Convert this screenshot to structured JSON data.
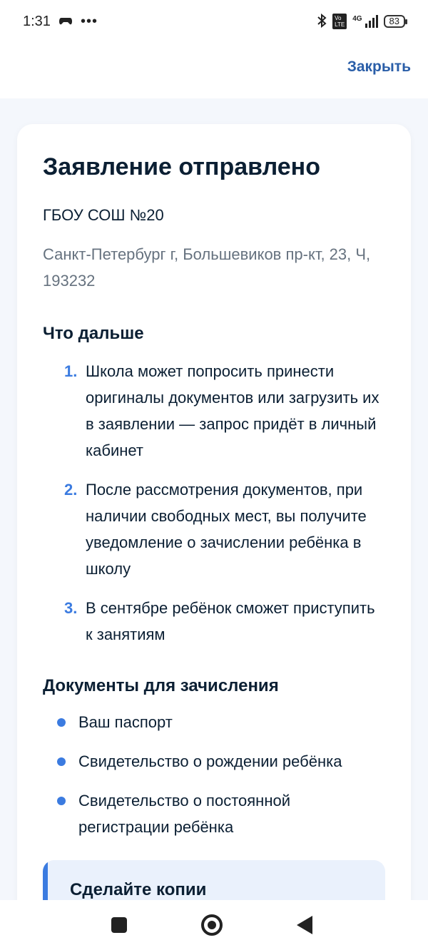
{
  "status": {
    "time": "1:31",
    "network": "4G",
    "battery": "83"
  },
  "header": {
    "close_label": "Закрыть"
  },
  "card": {
    "title": "Заявление отправлено",
    "school": "ГБОУ СОШ №20",
    "address": "Санкт-Петербург г, Большевиков пр-кт, 23, Ч, 193232",
    "next_heading": "Что дальше",
    "steps": [
      {
        "num": "1.",
        "text": "Школа может попросить принести оригиналы документов или загрузить их в заявлении — запрос придёт в личный кабинет"
      },
      {
        "num": "2.",
        "text": "После рассмотрения документов, при наличии свободных мест, вы получите уведомление о зачислении ребёнка в школу"
      },
      {
        "num": "3.",
        "text": "В сентябре ребёнок сможет приступить к занятиям"
      }
    ],
    "docs_heading": "Документы для зачисления",
    "docs": [
      "Ваш паспорт",
      "Свидетельство о рождении ребёнка",
      "Свидетельство о постоянной регистрации ребёнка"
    ],
    "copies_heading": "Сделайте копии"
  },
  "colors": {
    "accent": "#3b7be0",
    "link": "#2a5ea8",
    "text": "#0b1f33",
    "muted": "#66727f",
    "background": "#f4f7fc"
  },
  "icons": [
    "bluetooth-icon",
    "volte-icon",
    "signal-icon",
    "battery-icon",
    "gamepad-icon",
    "more-dots-icon",
    "nav-recents-icon",
    "nav-home-icon",
    "nav-back-icon"
  ]
}
